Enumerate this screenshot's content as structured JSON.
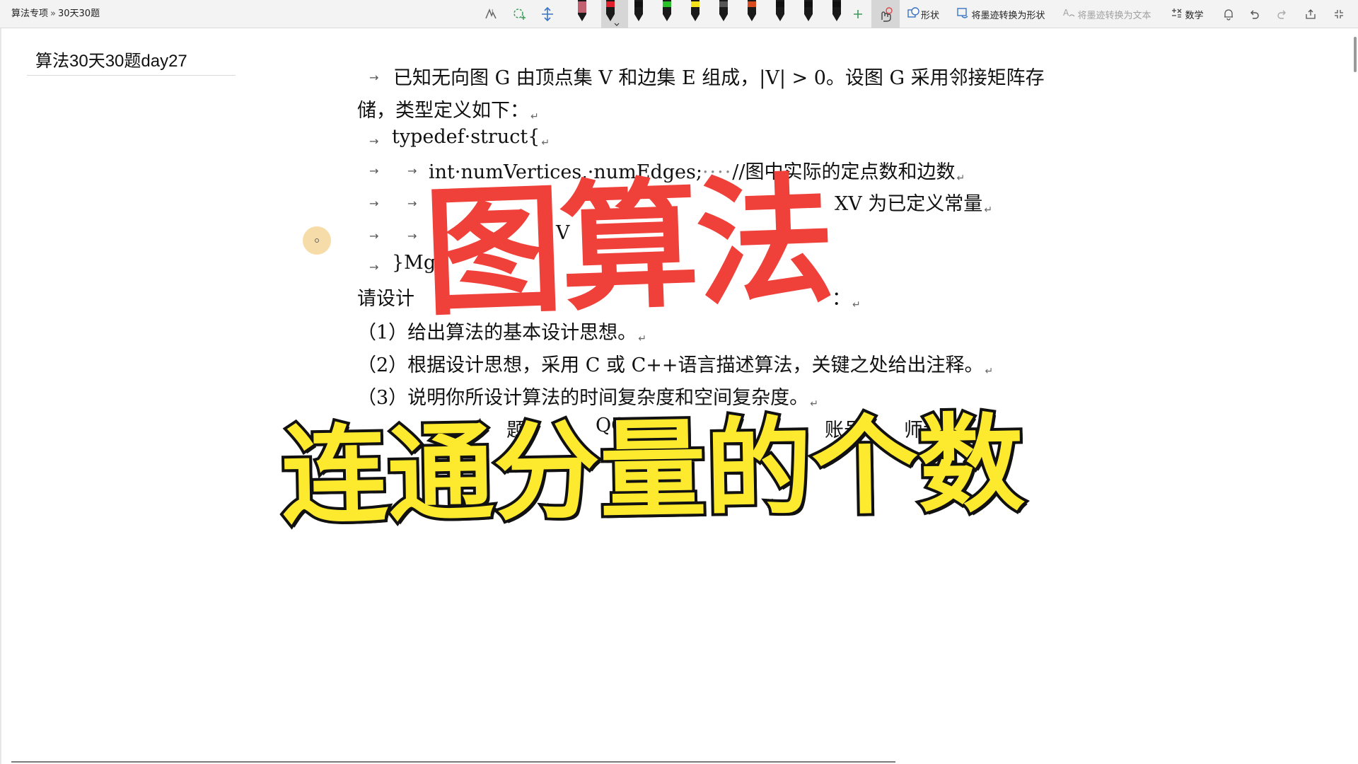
{
  "breadcrumb": {
    "section": "算法专项",
    "separator": "»",
    "page": "30天30题"
  },
  "toolbar": {
    "shapes_label": "形状",
    "ink_to_shape_label": "将墨迹转换为形状",
    "ink_to_text_label": "将墨迹转换为文本",
    "math_label": "数学",
    "pen_colors": [
      "#c06070",
      "#e0202a",
      "#111111",
      "#2bbf2b",
      "#f2e31a",
      "#555555",
      "#d84a1f",
      "#111111",
      "#111111",
      "#111111"
    ],
    "icons": [
      "ink-select-icon",
      "lasso-select-icon",
      "insert-space-icon",
      "add-pen-icon",
      "lasso-touch-icon",
      "shape-icon",
      "ink-to-shape-icon",
      "ink-to-text-icon",
      "math-icon",
      "bell-icon",
      "undo-icon",
      "redo-icon",
      "share-icon",
      "fullscreen-icon"
    ]
  },
  "page": {
    "title": "算法30天30题day27"
  },
  "doc": {
    "l1": "已知无向图 G 由顶点集 V 和边集 E 组成，|V| > 0。设图 G 采用邻接矩阵存",
    "l2": "储，类型定义如下：",
    "l3": "typedef·struct{",
    "l4a": "int·numVertices,·numEdges;",
    "l4dots": "····",
    "l4b": "//图中实际的定点数和边数",
    "l5": "XV 为已定义常量",
    "l6": "V",
    "l7": "}Mg",
    "l8a": "请设计",
    "l8b": "：",
    "l9": "（1）给出算法的基本设计思想。",
    "l10": "（2）根据设计思想，采用 C 或 C++语言描述算法，关键之处给出注释。",
    "l11": "（3）说明你所设计算法的时间复杂度和空间复杂度。",
    "l12a": "题",
    "l12b": "QQ",
    "l12c": "账号",
    "l12d": "师我",
    "para_mark": "↵",
    "arrow": "→"
  },
  "overlay": {
    "headline": "图算法",
    "subtitle": "连通分量的个数",
    "headline_color": "#f0403a",
    "subtitle_color": "#fde92d"
  }
}
